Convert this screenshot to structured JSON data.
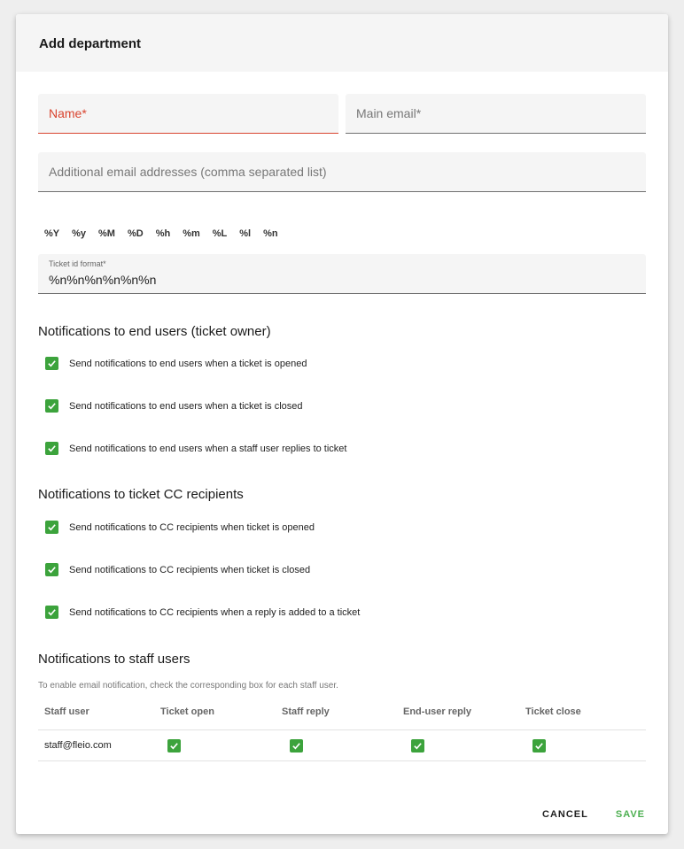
{
  "dialog": {
    "title": "Add department"
  },
  "form": {
    "name_placeholder": "Name*",
    "main_email_placeholder": "Main email*",
    "additional_emails_placeholder": "Additional email addresses (comma separated list)",
    "ticket_format_tokens": [
      "%Y",
      "%y",
      "%M",
      "%D",
      "%h",
      "%m",
      "%L",
      "%l",
      "%n"
    ],
    "ticket_id_format_label": "Ticket id format*",
    "ticket_id_format_value": "%n%n%n%n%n%n"
  },
  "end_users": {
    "title": "Notifications to end users (ticket owner)",
    "options": [
      {
        "label": "Send notifications to end users when a ticket is opened",
        "checked": true
      },
      {
        "label": "Send notifications to end users when a ticket is closed",
        "checked": true
      },
      {
        "label": "Send notifications to end users when a staff user replies to ticket",
        "checked": true
      }
    ]
  },
  "cc_recipients": {
    "title": "Notifications to ticket CC recipients",
    "options": [
      {
        "label": "Send notifications to CC recipients when ticket is opened",
        "checked": true
      },
      {
        "label": "Send notifications to CC recipients when ticket is closed",
        "checked": true
      },
      {
        "label": "Send notifications to CC recipients when a reply is added to a ticket",
        "checked": true
      }
    ]
  },
  "staff": {
    "title": "Notifications to staff users",
    "hint": "To enable email notification, check the corresponding box for each staff user.",
    "columns": [
      "Staff user",
      "Ticket open",
      "Staff reply",
      "End-user reply",
      "Ticket close"
    ],
    "rows": [
      {
        "user": "staff@fleio.com",
        "ticket_open": true,
        "staff_reply": true,
        "end_user_reply": true,
        "ticket_close": true
      }
    ]
  },
  "actions": {
    "cancel_label": "CANCEL",
    "save_label": "SAVE"
  },
  "colors": {
    "accent_green": "#3ca33c",
    "error_red": "#d9442f",
    "save_green": "#4caf50"
  },
  "icons": {
    "checkbox": "check-icon"
  }
}
